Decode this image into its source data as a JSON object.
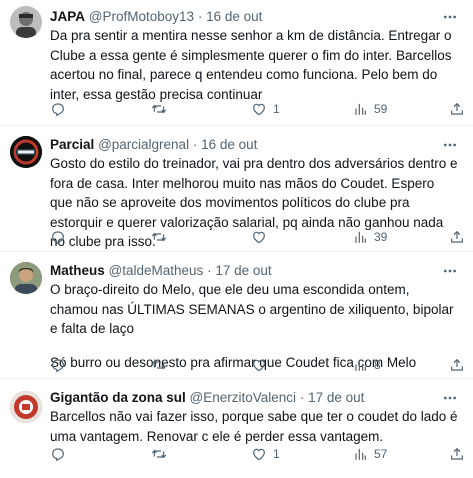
{
  "tweets": [
    {
      "name": "JAPA",
      "handle": "@ProfMotoboy13",
      "separator": "·",
      "time": "16 de out",
      "text": "Da pra sentir a mentira nesse senhor a km de distância. Entregar o Clube a essa gente é simplesmente querer o fim do inter. Barcellos acertou no final, parece q entendeu como funciona. Pelo bem do inter, essa gestão precisa continuar",
      "text2": "",
      "replies": "",
      "retweets": "",
      "likes": "1",
      "views": "59"
    },
    {
      "name": "Parcial",
      "handle": "@parcialgrenal",
      "separator": "·",
      "time": "16 de out",
      "text": "Gosto do estilo do treinador, vai pra dentro dos adversários dentro e fora de casa. Inter melhorou muito nas mãos do Coudet. Espero que não se aproveite dos movimentos políticos do clube pra estorquir e querer valorização salarial, pq ainda não ganhou nada no clube pra isso.",
      "text2": "",
      "replies": "",
      "retweets": "",
      "likes": "",
      "views": "39"
    },
    {
      "name": "Matheus",
      "handle": "@taldeMatheus",
      "separator": "·",
      "time": "17 de out",
      "text": "O braço-direito do Melo, que ele deu uma escondida ontem, chamou nas ÚLTIMAS SEMANAS o argentino de xiliquento, bipolar e falta de laço",
      "text2": "Só burro ou desonesto pra afirmar que Coudet fica com Melo",
      "replies": "",
      "retweets": "",
      "likes": "",
      "views": "8"
    },
    {
      "name": "Gigantão da zona sul",
      "handle": "@EnerzitoValenci",
      "separator": "·",
      "time": "17 de out",
      "text": "Barcellos não vai fazer isso, porque sabe que ter o coudet do lado é uma vantagem. Renovar c ele é perder essa vantagem.",
      "text2": "",
      "replies": "",
      "retweets": "",
      "likes": "1",
      "views": "57"
    }
  ]
}
